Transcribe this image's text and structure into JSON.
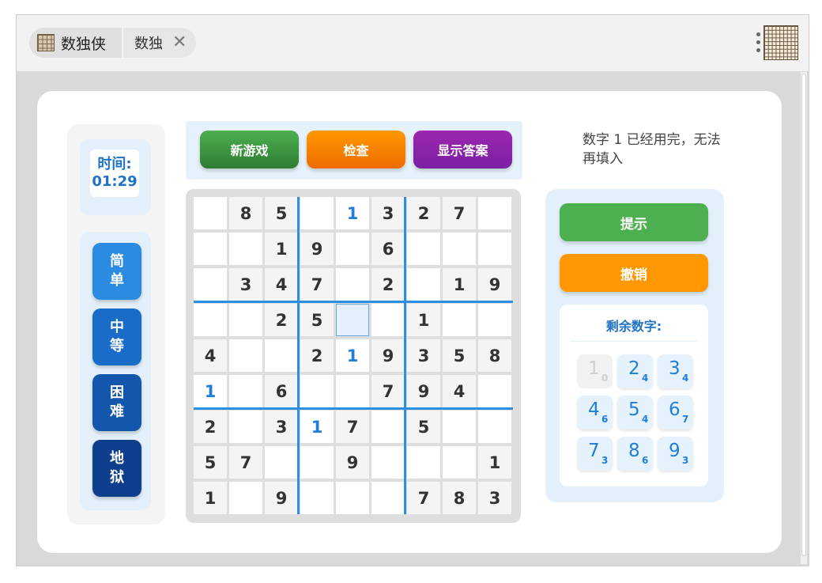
{
  "window": {
    "tab_title": "数独侠",
    "tab_sub": "数独",
    "close_glyph": "✕"
  },
  "timer": {
    "label": "时间:",
    "value": "01:29"
  },
  "difficulty": [
    {
      "label": "简",
      "label2": "单",
      "color": "#2b8be0"
    },
    {
      "label": "中",
      "label2": "等",
      "color": "#1a6cc9"
    },
    {
      "label": "困",
      "label2": "难",
      "color": "#1556ad"
    },
    {
      "label": "地",
      "label2": "狱",
      "color": "#0e3e8c"
    }
  ],
  "toolbar": {
    "new_game": "新游戏",
    "check": "检查",
    "show_answer": "显示答案"
  },
  "message": "数字 1 已经用完，无法再填入",
  "actions": {
    "hint": "提示",
    "undo": "撤销"
  },
  "remaining": {
    "title": "剩余数字:",
    "items": [
      {
        "digit": "1",
        "count": "0"
      },
      {
        "digit": "2",
        "count": "4"
      },
      {
        "digit": "3",
        "count": "4"
      },
      {
        "digit": "4",
        "count": "6"
      },
      {
        "digit": "5",
        "count": "4"
      },
      {
        "digit": "6",
        "count": "7"
      },
      {
        "digit": "7",
        "count": "3"
      },
      {
        "digit": "8",
        "count": "6"
      },
      {
        "digit": "9",
        "count": "3"
      }
    ]
  },
  "board": {
    "selected": [
      3,
      4
    ],
    "rows": [
      [
        "",
        "8",
        "5",
        "",
        "1",
        "3",
        "2",
        "7",
        ""
      ],
      [
        "",
        "",
        "1",
        "9",
        "",
        "6",
        "",
        "",
        ""
      ],
      [
        "",
        "3",
        "4",
        "7",
        "",
        "2",
        "",
        "1",
        "9"
      ],
      [
        "",
        "",
        "2",
        "5",
        "",
        "",
        "1",
        "",
        ""
      ],
      [
        "4",
        "",
        "",
        "2",
        "1",
        "9",
        "3",
        "5",
        "8"
      ],
      [
        "1",
        "",
        "6",
        "",
        "",
        "7",
        "9",
        "4",
        ""
      ],
      [
        "2",
        "",
        "3",
        "1",
        "7",
        "",
        "5",
        "",
        ""
      ],
      [
        "5",
        "7",
        "",
        "",
        "9",
        "",
        "",
        "",
        "1"
      ],
      [
        "1",
        "",
        "9",
        "",
        "",
        "",
        "7",
        "8",
        "3"
      ]
    ],
    "user_entries": [
      [
        0,
        4
      ],
      [
        4,
        4
      ],
      [
        5,
        0
      ],
      [
        6,
        3
      ]
    ]
  },
  "colors": {
    "accent_blue": "#1f73c6",
    "new_game": "#43a047",
    "check": "#fb8c00",
    "show_answer": "#8e24aa",
    "hint": "#4caf50",
    "undo": "#ff9800"
  }
}
